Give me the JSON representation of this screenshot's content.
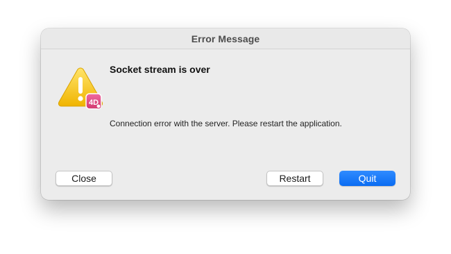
{
  "window": {
    "title": "Error Message"
  },
  "alert": {
    "icon": "warning-triangle-icon",
    "badge_icon": "4d-app-badge-icon",
    "badge_text": "4D",
    "heading": "Socket stream is over",
    "message": "Connection error with the server. Please restart the application."
  },
  "buttons": {
    "close_label": "Close",
    "restart_label": "Restart",
    "quit_label": "Quit"
  },
  "colors": {
    "accent": "#0a6cf2",
    "warning": "#f5c518",
    "badge": "#e0457b"
  }
}
